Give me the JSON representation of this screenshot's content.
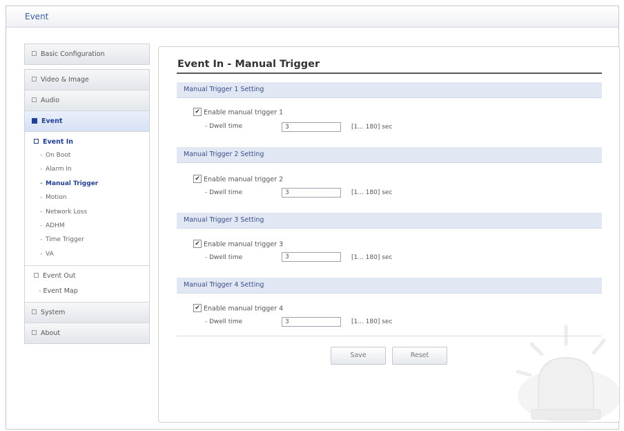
{
  "app": {
    "title": "Event"
  },
  "sidebar": {
    "basic_configuration": "Basic Configuration",
    "video_image": "Video & Image",
    "audio": "Audio",
    "event": "Event",
    "event_in": {
      "label": "Event In",
      "items": [
        "On Boot",
        "Alarm In",
        "Manual Trigger",
        "Motion",
        "Network Loss",
        "ADHM",
        "Time Trigger",
        "VA"
      ],
      "selected": "Manual Trigger"
    },
    "event_out": "Event Out",
    "event_map": "Event Map",
    "system": "System",
    "about": "About"
  },
  "main": {
    "title": "Event In - Manual Trigger",
    "sections": [
      {
        "header": "Manual Trigger 1 Setting",
        "checkbox_label": "Enable manual trigger 1",
        "checked": true,
        "dwell_label": "- Dwell time",
        "dwell_value": "3",
        "range": "[1... 180] sec"
      },
      {
        "header": "Manual Trigger 2 Setting",
        "checkbox_label": "Enable manual trigger 2",
        "checked": true,
        "dwell_label": "- Dwell time",
        "dwell_value": "3",
        "range": "[1... 180] sec"
      },
      {
        "header": "Manual Trigger 3 Setting",
        "checkbox_label": "Enable manual trigger 3",
        "checked": true,
        "dwell_label": "- Dwell time",
        "dwell_value": "3",
        "range": "[1... 180] sec"
      },
      {
        "header": "Manual Trigger 4 Setting",
        "checkbox_label": "Enable manual trigger 4",
        "checked": true,
        "dwell_label": "- Dwell time",
        "dwell_value": "3",
        "range": "[1... 180] sec"
      }
    ],
    "save_label": "Save",
    "reset_label": "Reset"
  },
  "icons": {
    "sidebar_bullet": "square-bullet-icon",
    "checkbox": "checkmark-icon",
    "decoration": "alarm-siren-icon"
  },
  "colors": {
    "accent": "#1f3f9a",
    "section_bg": "#e1e7f3"
  }
}
